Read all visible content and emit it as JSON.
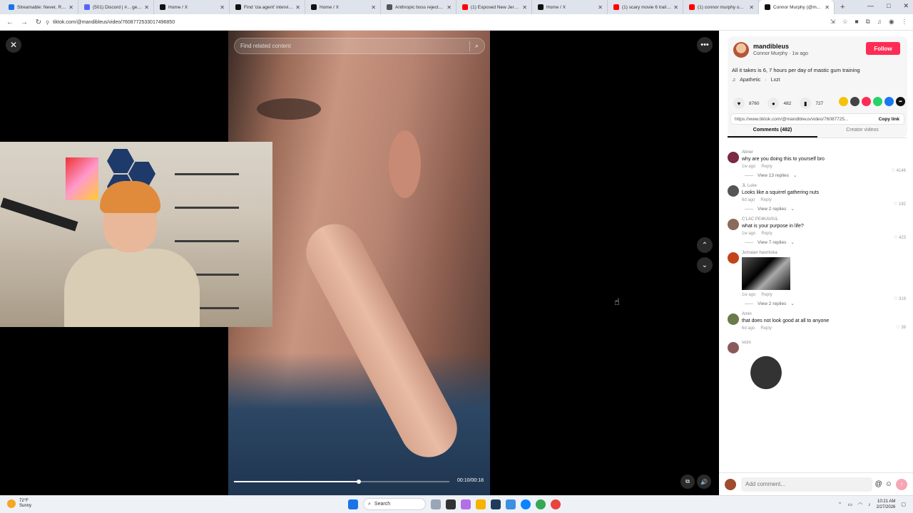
{
  "browser": {
    "tabs": [
      {
        "title": "Streamable: Never, RL Str",
        "color": "#1a73e8"
      },
      {
        "title": "(501) Discord | #... gene",
        "color": "#5865f2"
      },
      {
        "title": "Home / X",
        "color": "#111111"
      },
      {
        "title": "Find 'cia agent' interviews",
        "color": "#111111"
      },
      {
        "title": "Home / X",
        "color": "#111111"
      },
      {
        "title": "Anthropic boss rejects Pe",
        "color": "#555555"
      },
      {
        "title": "(1) Exposed New Jersey's",
        "color": "#ff0000"
      },
      {
        "title": "Home / X",
        "color": "#111111"
      },
      {
        "title": "(1) scary movie 6 trailer -",
        "color": "#ff0000"
      },
      {
        "title": "(1) connor murphy omeg",
        "color": "#ff0000"
      },
      {
        "title": "Connor Murphy (@m...",
        "color": "#111111"
      }
    ],
    "new_tab": "+",
    "url": "tiktok.com/@mandibleus/video/7608772533017496850"
  },
  "video": {
    "search_placeholder": "Find related content",
    "time": "00:10/00:18",
    "progress_fraction": 0.58
  },
  "author": {
    "username": "mandibleus",
    "display": "Connor Murphy · 1w ago",
    "follow_label": "Follow",
    "caption": "All it takes is 6, 7 hours per day of mastic gum training",
    "music": [
      "Apathetic",
      "Lxzt"
    ]
  },
  "stats": {
    "likes": "8760",
    "comments": "482",
    "saves": "727"
  },
  "share_colors": [
    "#f4c20d",
    "#444444",
    "#fe2c55",
    "#25d366",
    "#1877f2",
    "#111111"
  ],
  "link": {
    "url": "https://www.tiktok.com/@mandibleus/video/76087725...",
    "copy_label": "Copy link"
  },
  "panel_tabs": [
    "Comments (482)",
    "Creator videos"
  ],
  "comments": [
    {
      "user": "Abner",
      "text": "why are you doing this to yourself bro",
      "time": "1w ago",
      "reply": "Reply",
      "likes": "4146",
      "replies": "View 13 replies",
      "color": "#7a2a44"
    },
    {
      "user": "JL Luke",
      "text": "Looks like a squirrel gathering nuts",
      "time": "6d ago",
      "reply": "Reply",
      "likes": "182",
      "replies": "View 2 replies",
      "color": "#555555"
    },
    {
      "user": "C'LAC PE4KAVIUL",
      "text": "what is your purpose in life?",
      "time": "1w ago",
      "reply": "Reply",
      "likes": "423",
      "replies": "View 7 replies",
      "color": "#8a6a5a"
    },
    {
      "user": "Jumaian hasmiska",
      "text": "",
      "time": "1w ago",
      "reply": "Reply",
      "likes": "319",
      "replies": "View 2 replies",
      "color": "#c4441a"
    },
    {
      "user": "Amin",
      "text": "that does not look good at all to anyone",
      "time": "6d ago",
      "reply": "Reply",
      "likes": "38",
      "replies": "",
      "color": "#6a7a4a"
    },
    {
      "user": "sozo",
      "text": "",
      "time": "",
      "reply": "",
      "likes": "",
      "replies": "",
      "color": "#8a5a5a"
    }
  ],
  "comment_input": {
    "placeholder": "Add comment..."
  },
  "taskbar": {
    "weather_temp": "72°F",
    "weather_desc": "Sunny",
    "search_label": "Search",
    "time": "10:21 AM",
    "date": "2/27/2026"
  }
}
